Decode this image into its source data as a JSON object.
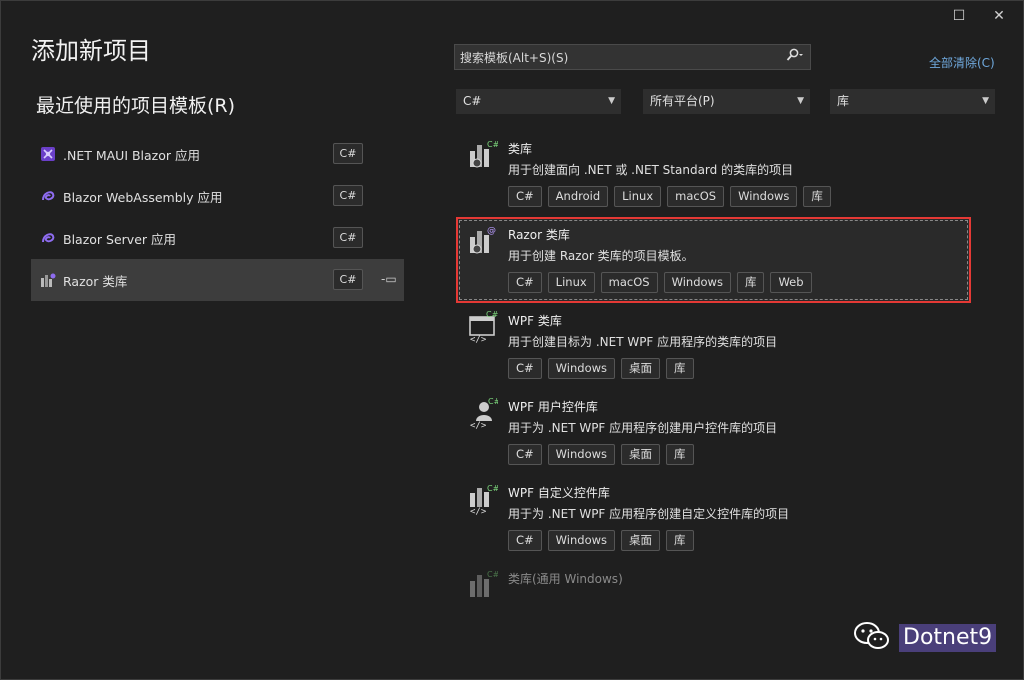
{
  "window": {
    "maximize_glyph": "☐",
    "close_glyph": "✕"
  },
  "title": "添加新项目",
  "recent_section": {
    "title": "最近使用的项目模板(R)",
    "items": [
      {
        "label": ".NET MAUI Blazor 应用",
        "lang": "C#",
        "icon": "maui-blazor-icon"
      },
      {
        "label": "Blazor WebAssembly 应用",
        "lang": "C#",
        "icon": "blazor-icon"
      },
      {
        "label": "Blazor Server 应用",
        "lang": "C#",
        "icon": "blazor-icon"
      },
      {
        "label": "Razor 类库",
        "lang": "C#",
        "icon": "razor-library-icon",
        "pin": "-▭"
      }
    ]
  },
  "search": {
    "placeholder": "搜索模板(Alt+S)(S)",
    "icon": "search-icon"
  },
  "clear_all": "全部清除(C)",
  "filters": {
    "language": "C#",
    "platform": "所有平台(P)",
    "project_type": "库"
  },
  "templates": [
    {
      "name": "类库",
      "desc": "用于创建面向 .NET 或 .NET Standard 的类库的项目",
      "tags": [
        "C#",
        "Android",
        "Linux",
        "macOS",
        "Windows",
        "库"
      ]
    },
    {
      "name": "Razor 类库",
      "desc": "用于创建 Razor 类库的项目模板。",
      "tags": [
        "C#",
        "Linux",
        "macOS",
        "Windows",
        "库",
        "Web"
      ]
    },
    {
      "name": "WPF 类库",
      "desc": "用于创建目标为 .NET WPF 应用程序的类库的项目",
      "tags": [
        "C#",
        "Windows",
        "桌面",
        "库"
      ]
    },
    {
      "name": "WPF 用户控件库",
      "desc": "用于为 .NET WPF 应用程序创建用户控件库的项目",
      "tags": [
        "C#",
        "Windows",
        "桌面",
        "库"
      ]
    },
    {
      "name": "WPF 自定义控件库",
      "desc": "用于为 .NET WPF 应用程序创建自定义控件库的项目",
      "tags": [
        "C#",
        "Windows",
        "桌面",
        "库"
      ]
    },
    {
      "name": "类库(通用 Windows)",
      "desc": "",
      "tags": []
    }
  ],
  "watermark": "Dotnet9",
  "colors": {
    "background": "#1f1f1f",
    "selection_border": "#e53935",
    "link": "#6fa8dc",
    "accent_purple": "#7b5cd6"
  }
}
